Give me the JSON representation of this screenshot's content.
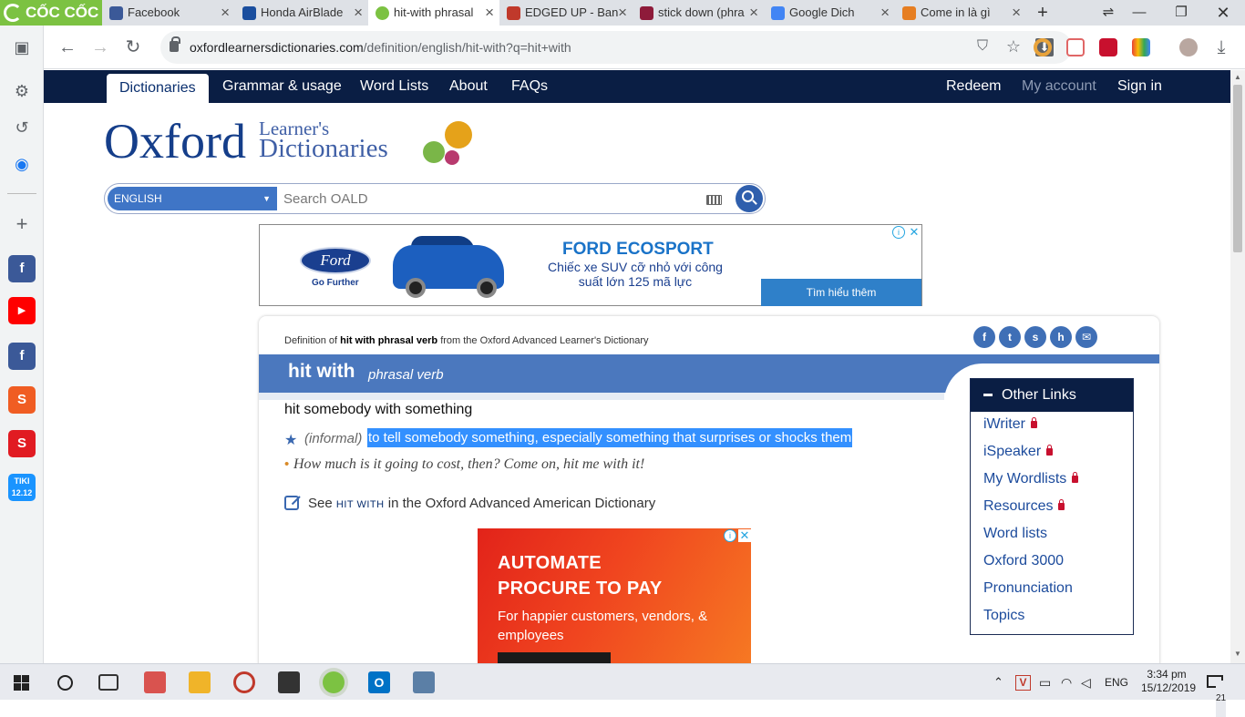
{
  "browser": {
    "brand": "CỐC CỐC",
    "tabs": [
      {
        "title": "Facebook",
        "active": false,
        "color": "#3b5998"
      },
      {
        "title": "Honda AirBlade",
        "active": false,
        "color": "#1a4e9e"
      },
      {
        "title": "hit-with phrasal",
        "active": true,
        "color": "#7cc242"
      },
      {
        "title": "EDGED UP - Ban",
        "active": false,
        "color": "#c0392b"
      },
      {
        "title": "stick down (phra",
        "active": false,
        "color": "#8e1b3a"
      },
      {
        "title": "Google Dich",
        "active": false,
        "color": "#4285f4"
      },
      {
        "title": "Come in là gì",
        "active": false,
        "color": "#e67e22"
      }
    ],
    "url_host": "oxfordlearnersdictionaries.com",
    "url_path": "/definition/english/hit-with?q=hit+with"
  },
  "site_nav": {
    "left": [
      "Dictionaries",
      "Grammar & usage",
      "Word Lists",
      "About",
      "FAQs"
    ],
    "right": [
      "Redeem",
      "My account",
      "Sign in"
    ]
  },
  "logo": {
    "line_oxford": "Oxford",
    "line1": "Learner's",
    "line2": "Dictionaries"
  },
  "search": {
    "language": "ENGLISH",
    "placeholder": "Search OALD"
  },
  "ad_top": {
    "brand": "Ford",
    "tagline": "Go Further",
    "title": "FORD ECOSPORT",
    "subtitle": "Chiếc xe SUV cỡ nhỏ với công suất lớn 125 mã lực",
    "cta": "Tìm hiểu thêm"
  },
  "entry": {
    "definition_of_prefix": "Definition of",
    "definition_of_term": "hit with phrasal verb",
    "definition_of_suffix": "from the Oxford Advanced Learner's Dictionary",
    "headword": "hit with",
    "pos": "phrasal verb",
    "sense_pattern": "hit somebody with something",
    "label": "(informal)",
    "definition": "to tell somebody something, especially something that surprises or shocks them",
    "example": "How much is it going to cost, then? Come on, hit me with it!",
    "see_prefix": "See",
    "see_term": "HIT WITH",
    "see_suffix": "in the Oxford Advanced American Dictionary",
    "share_icons": [
      "facebook-icon",
      "twitter-icon",
      "stumbleupon-icon",
      "hi5-icon",
      "email-icon"
    ]
  },
  "ad_bottom": {
    "headline_1": "AUTOMATE",
    "headline_2": "PROCURE TO PAY",
    "body": "For happier customers, vendors, & employees"
  },
  "other_links": {
    "title": "Other Links",
    "items": [
      {
        "label": "iWriter",
        "locked": true
      },
      {
        "label": "iSpeaker",
        "locked": true
      },
      {
        "label": "My Wordlists",
        "locked": true
      },
      {
        "label": "Resources",
        "locked": true
      },
      {
        "label": "Word lists",
        "locked": false
      },
      {
        "label": "Oxford 3000",
        "locked": false
      },
      {
        "label": "Pronunciation",
        "locked": false
      },
      {
        "label": "Topics",
        "locked": false
      }
    ]
  },
  "taskbar": {
    "language": "ENG",
    "time": "3:34 pm",
    "date": "15/12/2019",
    "notifications": "21"
  },
  "colors": {
    "nav_bg": "#0a1e44",
    "accent_blue": "#4b78be",
    "selection": "#3390ff",
    "brand_green": "#7cc242"
  }
}
